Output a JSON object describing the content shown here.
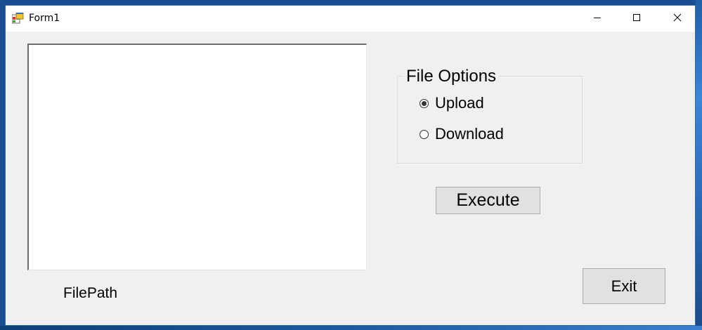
{
  "window": {
    "title": "Form1",
    "controls": {
      "minimize_icon": "minimize-icon",
      "maximize_icon": "maximize-icon",
      "close_icon": "close-icon"
    }
  },
  "form": {
    "file_path_text": "",
    "file_path_label": "FilePath",
    "file_options": {
      "title": "File Options",
      "options": [
        {
          "label": "Upload",
          "checked": true
        },
        {
          "label": "Download",
          "checked": false
        }
      ]
    },
    "execute_label": "Execute",
    "exit_label": "Exit"
  },
  "colors": {
    "window_bg": "#f0f0f0",
    "titlebar_bg": "#ffffff",
    "button_bg": "#e1e1e1",
    "button_border": "#adadad",
    "window_border": "#2f69b3"
  }
}
